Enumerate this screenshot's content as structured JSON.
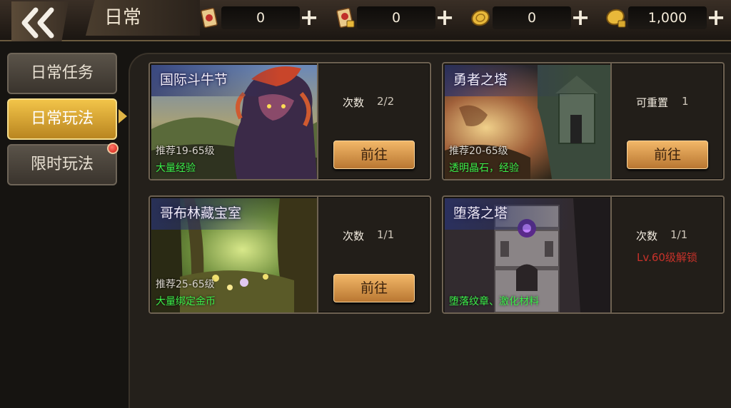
{
  "header": {
    "title": "日常",
    "currencies": [
      {
        "icon": "scroll-icon",
        "value": "0"
      },
      {
        "icon": "locked-scroll-icon",
        "value": "0"
      },
      {
        "icon": "gold-coin-icon",
        "value": "0"
      },
      {
        "icon": "locked-gold-coin-icon",
        "value": "1,000"
      }
    ],
    "plus_label": "+"
  },
  "sidebar": {
    "items": [
      {
        "label": "日常任务",
        "active": false
      },
      {
        "label": "日常玩法",
        "active": true
      },
      {
        "label": "限时玩法",
        "active": false,
        "notification": true
      }
    ]
  },
  "cards": [
    {
      "name": "国际斗牛节",
      "recommend": "推荐19-65级",
      "reward": "大量经验",
      "count_label": "次数",
      "count_value": "2/2",
      "button": "前往"
    },
    {
      "name": "勇者之塔",
      "recommend": "推荐20-65级",
      "reward": "透明晶石，经验",
      "count_label": "可重置",
      "count_value": "1",
      "button": "前往"
    },
    {
      "name": "哥布林藏宝室",
      "recommend": "推荐25-65级",
      "reward": "大量绑定金币",
      "count_label": "次数",
      "count_value": "1/1",
      "button": "前往"
    },
    {
      "name": "堕落之塔",
      "recommend": "",
      "reward": "堕落纹章、激化材料",
      "count_label": "次数",
      "count_value": "1/1",
      "lock_text": "Lv.60级解锁"
    }
  ],
  "colors": {
    "accent_gold": "#f2c449",
    "reward_green": "#3cf04a",
    "lock_red": "#c8322a",
    "button_orange": "#e0a050"
  }
}
